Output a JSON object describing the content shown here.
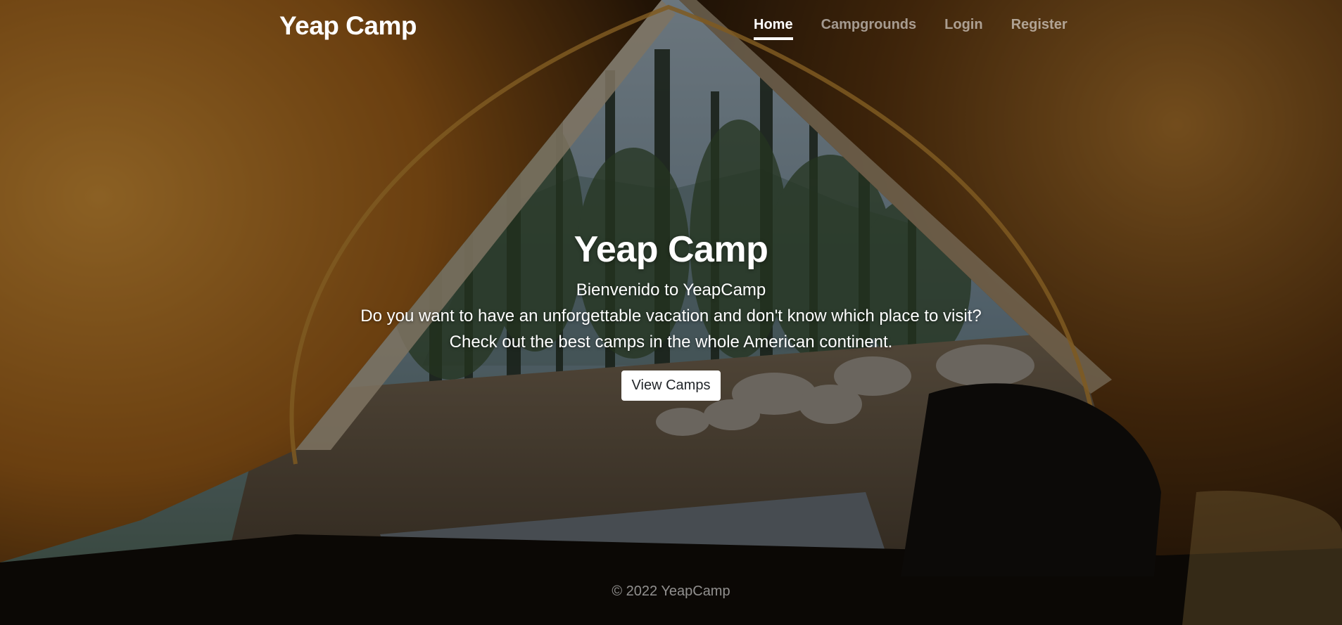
{
  "header": {
    "brand": "Yeap Camp",
    "nav": [
      {
        "label": "Home",
        "active": true
      },
      {
        "label": "Campgrounds",
        "active": false
      },
      {
        "label": "Login",
        "active": false
      },
      {
        "label": "Register",
        "active": false
      }
    ]
  },
  "hero": {
    "title": "Yeap Camp",
    "lines": [
      "Bienvenido to YeapCamp",
      "Do you want to have an unforgettable vacation and don't know which place to visit?",
      "Check out the best camps in the whole American continent."
    ],
    "button_label": "View Camps"
  },
  "footer": {
    "copyright": "© 2022 YeapCamp"
  },
  "colors": {
    "tent": "#c9822a",
    "tent_dark": "#5a3510",
    "forest": "#3d5a3a",
    "sky": "#9fb6c8",
    "ground": "#7a6a55",
    "text": "#ffffff",
    "muted_text": "#a9a9a9"
  }
}
